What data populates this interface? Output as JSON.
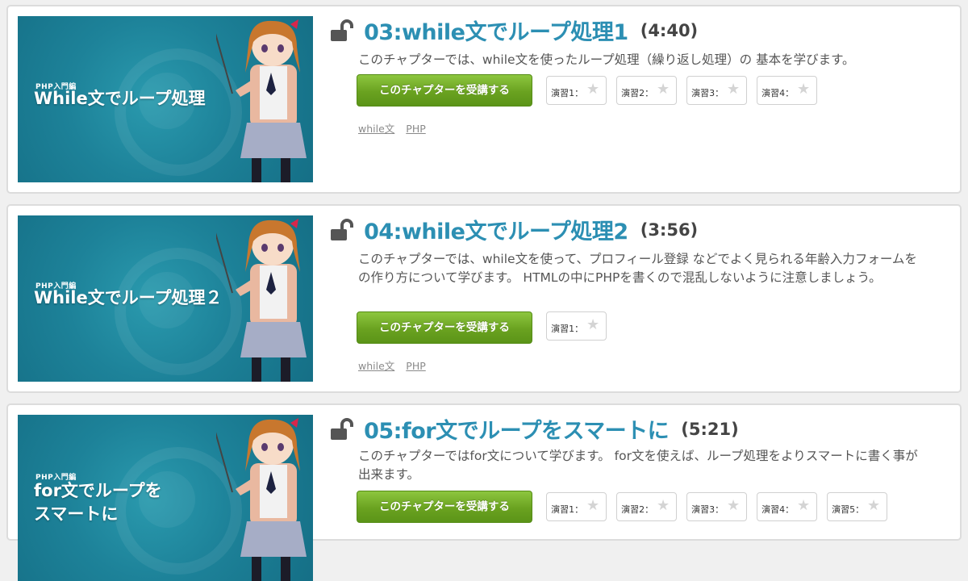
{
  "chapters": [
    {
      "thumb_kicker": "PHP入門編",
      "thumb_title": "While文でループ処理",
      "title": "03:while文でループ処理1",
      "duration": "(4:40)",
      "desc": "このチャプターでは、while文を使ったループ処理（繰り返し処理）の 基本を学びます。",
      "button": "このチャプターを受講する",
      "exercises": [
        "演習1：",
        "演習2：",
        "演習3：",
        "演習4："
      ],
      "tags": [
        "while文",
        "PHP"
      ]
    },
    {
      "thumb_kicker": "PHP入門編",
      "thumb_title": "While文でループ処理２",
      "title": "04:while文でループ処理2",
      "duration": "(3:56)",
      "desc": "このチャプターでは、while文を使って、プロフィール登録 などでよく見られる年齢入力フォームをの作り方について学びます。 HTMLの中にPHPを書くので混乱しないように注意しましょう。",
      "button": "このチャプターを受講する",
      "exercises": [
        "演習1："
      ],
      "tags": [
        "while文",
        "PHP"
      ]
    },
    {
      "thumb_kicker": "PHP入門編",
      "thumb_title": "for文でループを\nスマートに",
      "title": "05:for文でループをスマートに",
      "duration": "(5:21)",
      "desc": "このチャプターではfor文について学びます。 for文を使えば、ループ処理をよりスマートに書く事が出来ます。",
      "button": "このチャプターを受講する",
      "exercises": [
        "演習1：",
        "演習2：",
        "演習3：",
        "演習4：",
        "演習5："
      ],
      "tags": []
    }
  ]
}
